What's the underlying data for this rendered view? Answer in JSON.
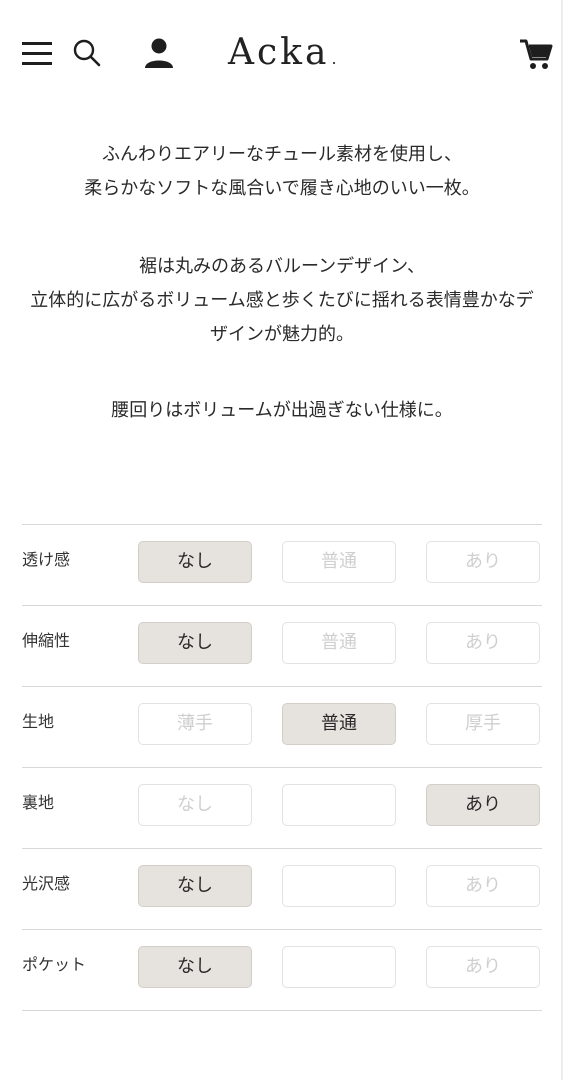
{
  "header": {
    "logo": "Acka",
    "logo_dot": "."
  },
  "description": {
    "paragraphs": [
      [
        "ふんわりエアリーなチュール素材を使用し、",
        "柔らかなソフトな風合いで履き心地のいい一枚。"
      ],
      [
        "裾は丸みのあるバルーンデザイン、",
        "立体的に広がるボリューム感と歩くたびに揺れる表情豊かなデザインが魅力的。"
      ],
      [
        "腰回りはボリュームが出過ぎない仕様に。"
      ]
    ]
  },
  "spec": {
    "rows": [
      {
        "label": "透け感",
        "options": [
          "なし",
          "普通",
          "あり"
        ],
        "selected": 0
      },
      {
        "label": "伸縮性",
        "options": [
          "なし",
          "普通",
          "あり"
        ],
        "selected": 0
      },
      {
        "label": "生地",
        "options": [
          "薄手",
          "普通",
          "厚手"
        ],
        "selected": 1
      },
      {
        "label": "裏地",
        "options": [
          "なし",
          "",
          "あり"
        ],
        "selected": 2
      },
      {
        "label": "光沢感",
        "options": [
          "なし",
          "",
          "あり"
        ],
        "selected": 0
      },
      {
        "label": "ポケット",
        "options": [
          "なし",
          "",
          "あり"
        ],
        "selected": 0
      }
    ]
  },
  "icons": {
    "menu": "menu-icon",
    "search": "search-icon",
    "user": "user-icon",
    "cart": "cart-icon"
  },
  "colors": {
    "selected_bg": "#e6e3de",
    "unselected_text": "#cfcfcf",
    "text": "#2a2a2a"
  }
}
